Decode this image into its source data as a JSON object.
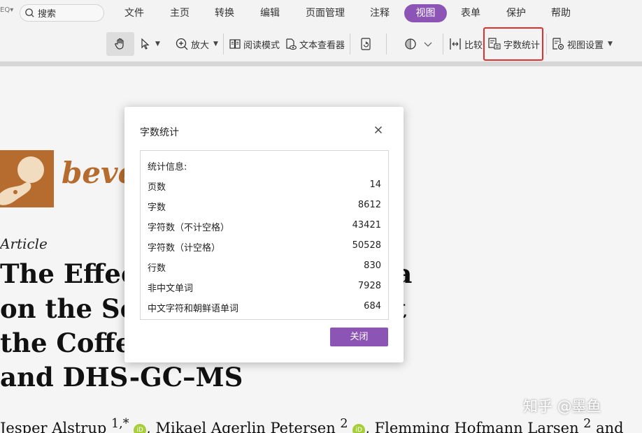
{
  "colors": {
    "accent": "#8c55b5",
    "highlight": "#e0302d",
    "journal": "#b56c2e",
    "orcid": "#a6ce39"
  },
  "menubar": {
    "tool_label": "EQ▾",
    "search_label": "搜索",
    "items": [
      "文件",
      "主页",
      "转换",
      "编辑",
      "页面管理",
      "注释",
      "视图",
      "表单",
      "保护",
      "帮助"
    ],
    "active_item": "视图"
  },
  "toolbar": {
    "zoom_in_label": "放大",
    "read_mode_label": "阅读模式",
    "text_viewer_label": "文本查看器",
    "compare_label": "比较",
    "word_count_label": "字数统计",
    "view_settings_label": "视图设置"
  },
  "document": {
    "journal_name": "beve",
    "article_type": "Article",
    "title_lines": [
      "The Effec                                  nent Time Modula",
      "on the Se                                  hemical Composit",
      "the Coffe                               by NMR",
      "and DHS-GC–MS"
    ],
    "authors_1": "Jesper Alstrup ",
    "authors_1_sup": "1,*",
    "authors_2": ", Mikael Agerlin Petersen ",
    "authors_2_sup": "2",
    "authors_3": ", Flemming Hofmann Larsen ",
    "authors_3_sup": "2",
    "authors_3_tail": " and",
    "orcid_text": "iD",
    "watermark": "知乎 @墨鱼"
  },
  "dialog": {
    "title": "字数统计",
    "heading": "统计信息:",
    "rows": [
      {
        "label": "页数",
        "value": "14"
      },
      {
        "label": "字数",
        "value": "8612"
      },
      {
        "label": "字符数（不计空格）",
        "value": "43421"
      },
      {
        "label": "字符数（计空格）",
        "value": "50528"
      },
      {
        "label": "行数",
        "value": "830"
      },
      {
        "label": "非中文单词",
        "value": "7928"
      },
      {
        "label": "中文字符和朝鲜语单词",
        "value": "684"
      }
    ],
    "close_button_label": "关闭"
  }
}
